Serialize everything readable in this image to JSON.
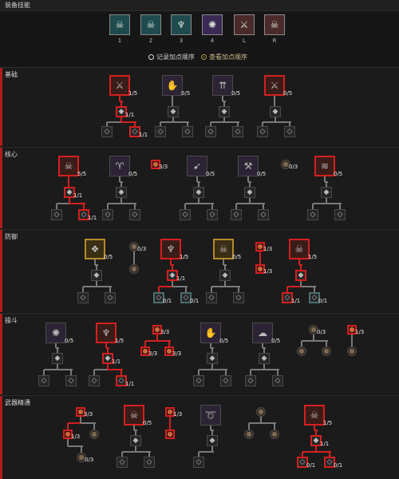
{
  "header": {
    "title": "装备技能"
  },
  "equip": {
    "slots": [
      {
        "key": "1",
        "icon": "demon-skull-icon"
      },
      {
        "key": "2",
        "icon": "twin-skulls-icon"
      },
      {
        "key": "3",
        "icon": "green-demon-icon"
      },
      {
        "key": "4",
        "icon": "purple-swirl-icon"
      },
      {
        "key": "L",
        "icon": "sword-strike-icon"
      },
      {
        "key": "R",
        "icon": "skull-summon-icon"
      }
    ],
    "options": [
      {
        "label": "记录加点顺序",
        "selected": false
      },
      {
        "label": "查看加点顺序",
        "selected": true
      }
    ]
  },
  "sections": [
    {
      "label": "基础"
    },
    {
      "label": "核心"
    },
    {
      "label": "防御"
    },
    {
      "label": "操斗"
    },
    {
      "label": "武器精通"
    }
  ],
  "nodes": [
    {
      "id": "s1-a",
      "section": 1,
      "icon": "sword-icon",
      "style": "red",
      "count": "1/5"
    },
    {
      "id": "s1-a1",
      "section": 1,
      "icon": "upgrade-icon",
      "style": "red",
      "count": "1/1"
    },
    {
      "id": "s1-a1a",
      "section": 1,
      "icon": "mod-icon",
      "style": "plain"
    },
    {
      "id": "s1-a1b",
      "section": 1,
      "icon": "mod-icon",
      "style": "red",
      "count": "1/1"
    },
    {
      "id": "s1-b",
      "section": 1,
      "icon": "claw-icon",
      "style": "plain",
      "count": "0/5"
    },
    {
      "id": "s1-b1",
      "section": 1,
      "icon": "upgrade-icon",
      "style": "plain"
    },
    {
      "id": "s1-b1a",
      "section": 1,
      "icon": "mod-icon",
      "style": "plain"
    },
    {
      "id": "s1-b1b",
      "section": 1,
      "icon": "mod-icon",
      "style": "plain"
    },
    {
      "id": "s1-c",
      "section": 1,
      "icon": "arrows-icon",
      "style": "plain",
      "count": "0/5"
    },
    {
      "id": "s1-c1",
      "section": 1,
      "icon": "upgrade-icon",
      "style": "plain"
    },
    {
      "id": "s1-c1a",
      "section": 1,
      "icon": "mod-icon",
      "style": "plain"
    },
    {
      "id": "s1-c1b",
      "section": 1,
      "icon": "mod-icon",
      "style": "plain"
    },
    {
      "id": "s1-d",
      "section": 1,
      "icon": "fire-blade-icon",
      "style": "red",
      "count": "0/5"
    },
    {
      "id": "s1-d1",
      "section": 1,
      "icon": "upgrade-icon",
      "style": "plain"
    },
    {
      "id": "s1-d1a",
      "section": 1,
      "icon": "mod-icon",
      "style": "plain"
    },
    {
      "id": "s1-d1b",
      "section": 1,
      "icon": "mod-icon",
      "style": "plain"
    },
    {
      "id": "s2-a",
      "section": 2,
      "icon": "skull-icon",
      "style": "red",
      "count": "5/5"
    },
    {
      "id": "s2-a1",
      "section": 2,
      "icon": "upgrade-icon",
      "style": "red",
      "count": "1/1"
    },
    {
      "id": "s2-a1a",
      "section": 2,
      "icon": "mod-icon",
      "style": "plain"
    },
    {
      "id": "s2-a1b",
      "section": 2,
      "icon": "mod-icon",
      "style": "red",
      "count": "1/1"
    },
    {
      "id": "s2-b",
      "section": 2,
      "icon": "chalice-icon",
      "style": "plain",
      "count": "0/5"
    },
    {
      "id": "s2-b1",
      "section": 2,
      "icon": "upgrade-icon",
      "style": "plain"
    },
    {
      "id": "s2-b1a",
      "section": 2,
      "icon": "mod-icon",
      "style": "plain"
    },
    {
      "id": "s2-b1b",
      "section": 2,
      "icon": "mod-icon",
      "style": "plain"
    },
    {
      "id": "s2-p1",
      "section": 2,
      "icon": "passive-icon",
      "style": "redf",
      "count": "3/3"
    },
    {
      "id": "s2-c",
      "section": 2,
      "icon": "bone-spear-icon",
      "style": "plain",
      "count": "0/5"
    },
    {
      "id": "s2-c1",
      "section": 2,
      "icon": "upgrade-icon",
      "style": "plain"
    },
    {
      "id": "s2-c1a",
      "section": 2,
      "icon": "mod-icon",
      "style": "plain"
    },
    {
      "id": "s2-c1b",
      "section": 2,
      "icon": "mod-icon",
      "style": "plain"
    },
    {
      "id": "s2-d",
      "section": 2,
      "icon": "axes-icon",
      "style": "plain",
      "count": "0/5"
    },
    {
      "id": "s2-d1",
      "section": 2,
      "icon": "upgrade-icon",
      "style": "plain"
    },
    {
      "id": "s2-d1a",
      "section": 2,
      "icon": "mod-icon",
      "style": "plain"
    },
    {
      "id": "s2-d1b",
      "section": 2,
      "icon": "mod-icon",
      "style": "plain"
    },
    {
      "id": "s2-p2",
      "section": 2,
      "icon": "passive-icon",
      "style": "round",
      "count": "0/3"
    },
    {
      "id": "s2-e",
      "section": 2,
      "icon": "blood-wave-icon",
      "style": "red",
      "count": "0/5"
    },
    {
      "id": "s2-e1",
      "section": 2,
      "icon": "upgrade-icon",
      "style": "plain"
    },
    {
      "id": "s2-e1a",
      "section": 2,
      "icon": "mod-icon",
      "style": "plain"
    },
    {
      "id": "s2-e1b",
      "section": 2,
      "icon": "mod-icon",
      "style": "plain"
    },
    {
      "id": "s3-a",
      "section": 3,
      "icon": "tome-icon",
      "style": "gold",
      "count": "0/5"
    },
    {
      "id": "s3-a1",
      "section": 3,
      "icon": "upgrade-icon",
      "style": "plain"
    },
    {
      "id": "s3-a1a",
      "section": 3,
      "icon": "mod-icon",
      "style": "plain"
    },
    {
      "id": "s3-a1b",
      "section": 3,
      "icon": "mod-icon",
      "style": "plain"
    },
    {
      "id": "s3-p1",
      "section": 3,
      "icon": "passive-icon",
      "style": "round",
      "count": "0/3"
    },
    {
      "id": "s3-p2",
      "section": 3,
      "icon": "passive-icon",
      "style": "round"
    },
    {
      "id": "s3-b",
      "section": 3,
      "icon": "demon-icon",
      "style": "red",
      "count": "1/5"
    },
    {
      "id": "s3-b1",
      "section": 3,
      "icon": "upgrade-icon",
      "style": "red",
      "count": "1/1"
    },
    {
      "id": "s3-b1a",
      "section": 3,
      "icon": "mod-icon",
      "style": "teal",
      "count": "0/1"
    },
    {
      "id": "s3-b1b",
      "section": 3,
      "icon": "mod-icon",
      "style": "teal",
      "count": "0/1"
    },
    {
      "id": "s3-c",
      "section": 3,
      "icon": "skull-lantern-icon",
      "style": "gold",
      "count": "0/5"
    },
    {
      "id": "s3-c1",
      "section": 3,
      "icon": "upgrade-icon",
      "style": "plain"
    },
    {
      "id": "s3-c1a",
      "section": 3,
      "icon": "mod-icon",
      "style": "plain"
    },
    {
      "id": "s3-c1b",
      "section": 3,
      "icon": "mod-icon",
      "style": "plain"
    },
    {
      "id": "s3-p3",
      "section": 3,
      "icon": "passive-icon",
      "style": "redf",
      "count": "1/3"
    },
    {
      "id": "s3-p4",
      "section": 3,
      "icon": "passive-icon",
      "style": "redf",
      "count": "1/3"
    },
    {
      "id": "s3-d",
      "section": 3,
      "icon": "twin-skulls-icon",
      "style": "red",
      "count": "1/5"
    },
    {
      "id": "s3-d1",
      "section": 3,
      "icon": "upgrade-icon",
      "style": "red"
    },
    {
      "id": "s3-d1a",
      "section": 3,
      "icon": "mod-icon",
      "style": "red",
      "count": "1/1"
    },
    {
      "id": "s3-d1b",
      "section": 3,
      "icon": "mod-icon",
      "style": "teal",
      "count": "0/1"
    },
    {
      "id": "s4-a",
      "section": 4,
      "icon": "purple-swirl-icon",
      "style": "plain",
      "count": "0/5"
    },
    {
      "id": "s4-a1",
      "section": 4,
      "icon": "upgrade-icon",
      "style": "plain"
    },
    {
      "id": "s4-a1a",
      "section": 4,
      "icon": "mod-icon",
      "style": "plain"
    },
    {
      "id": "s4-a1b",
      "section": 4,
      "icon": "mod-icon",
      "style": "plain"
    },
    {
      "id": "s4-b",
      "section": 4,
      "icon": "green-demon-icon",
      "style": "red",
      "count": "1/5"
    },
    {
      "id": "s4-b1",
      "section": 4,
      "icon": "upgrade-icon",
      "style": "red",
      "count": "1/1"
    },
    {
      "id": "s4-b1a",
      "section": 4,
      "icon": "mod-icon",
      "style": "plain"
    },
    {
      "id": "s4-b1b",
      "section": 4,
      "icon": "mod-icon",
      "style": "red",
      "count": "1/1"
    },
    {
      "id": "s4-p1",
      "section": 4,
      "icon": "passive-icon",
      "style": "redf",
      "count": "3/3"
    },
    {
      "id": "s4-p2",
      "section": 4,
      "icon": "passive-icon",
      "style": "redf",
      "count": "3/3"
    },
    {
      "id": "s4-p3",
      "section": 4,
      "icon": "passive-icon",
      "style": "redf",
      "count": "3/3"
    },
    {
      "id": "s4-c",
      "section": 4,
      "icon": "bone-hand-icon",
      "style": "plain",
      "count": "0/5"
    },
    {
      "id": "s4-c1",
      "section": 4,
      "icon": "upgrade-icon",
      "style": "plain"
    },
    {
      "id": "s4-c1a",
      "section": 4,
      "icon": "mod-icon",
      "style": "plain"
    },
    {
      "id": "s4-c1b",
      "section": 4,
      "icon": "mod-icon",
      "style": "plain"
    },
    {
      "id": "s4-d",
      "section": 4,
      "icon": "skull-cloud-icon",
      "style": "plain",
      "count": "0/5"
    },
    {
      "id": "s4-d1",
      "section": 4,
      "icon": "upgrade-icon",
      "style": "plain"
    },
    {
      "id": "s4-d1a",
      "section": 4,
      "icon": "mod-icon",
      "style": "plain"
    },
    {
      "id": "s4-d1b",
      "section": 4,
      "icon": "mod-icon",
      "style": "plain"
    },
    {
      "id": "s4-p4",
      "section": 4,
      "icon": "passive-icon",
      "style": "round",
      "count": "0/3"
    },
    {
      "id": "s4-p5",
      "section": 4,
      "icon": "passive-icon",
      "style": "round"
    },
    {
      "id": "s4-p6",
      "section": 4,
      "icon": "passive-icon",
      "style": "round"
    },
    {
      "id": "s4-p7",
      "section": 4,
      "icon": "passive-icon",
      "style": "redf",
      "count": "1/3"
    },
    {
      "id": "s4-p8",
      "section": 4,
      "icon": "passive-icon",
      "style": "round"
    },
    {
      "id": "s5-p1",
      "section": 5,
      "icon": "passive-icon",
      "style": "redf",
      "count": "3/3"
    },
    {
      "id": "s5-p2",
      "section": 5,
      "icon": "passive-icon",
      "style": "redf",
      "count": "1/3"
    },
    {
      "id": "s5-p3",
      "section": 5,
      "icon": "passive-icon",
      "style": "round"
    },
    {
      "id": "s5-p4",
      "section": 5,
      "icon": "passive-icon",
      "style": "round",
      "count": "0/3"
    },
    {
      "id": "s5-a",
      "section": 5,
      "icon": "fire-skull-icon",
      "style": "red",
      "count": "0/5"
    },
    {
      "id": "s5-a1",
      "section": 5,
      "icon": "upgrade-icon",
      "style": "plain"
    },
    {
      "id": "s5-a1a",
      "section": 5,
      "icon": "mod-icon",
      "style": "plain"
    },
    {
      "id": "s5-a1b",
      "section": 5,
      "icon": "mod-icon",
      "style": "plain"
    },
    {
      "id": "s5-p5",
      "section": 5,
      "icon": "passive-icon",
      "style": "redf",
      "count": "1/3"
    },
    {
      "id": "s5-p6",
      "section": 5,
      "icon": "passive-icon",
      "style": "redf"
    },
    {
      "id": "s5-b",
      "section": 5,
      "icon": "bone-whip-icon",
      "style": "plain"
    },
    {
      "id": "s5-b1",
      "section": 5,
      "icon": "upgrade-icon",
      "style": "plain"
    },
    {
      "id": "s5-b1a",
      "section": 5,
      "icon": "mod-icon",
      "style": "plain"
    },
    {
      "id": "s5-p7",
      "section": 5,
      "icon": "passive-icon",
      "style": "round"
    },
    {
      "id": "s5-p8",
      "section": 5,
      "icon": "passive-icon",
      "style": "round"
    },
    {
      "id": "s5-p9",
      "section": 5,
      "icon": "passive-icon",
      "style": "round"
    },
    {
      "id": "s5-c",
      "section": 5,
      "icon": "skull-summon-icon",
      "style": "red",
      "count": "1/5"
    },
    {
      "id": "s5-c1",
      "section": 5,
      "icon": "upgrade-icon",
      "style": "red",
      "count": "1/1"
    },
    {
      "id": "s5-c1a",
      "section": 5,
      "icon": "mod-icon",
      "style": "red",
      "count": "0/1"
    },
    {
      "id": "s5-c1b",
      "section": 5,
      "icon": "mod-icon",
      "style": "red",
      "count": "0/1"
    }
  ]
}
